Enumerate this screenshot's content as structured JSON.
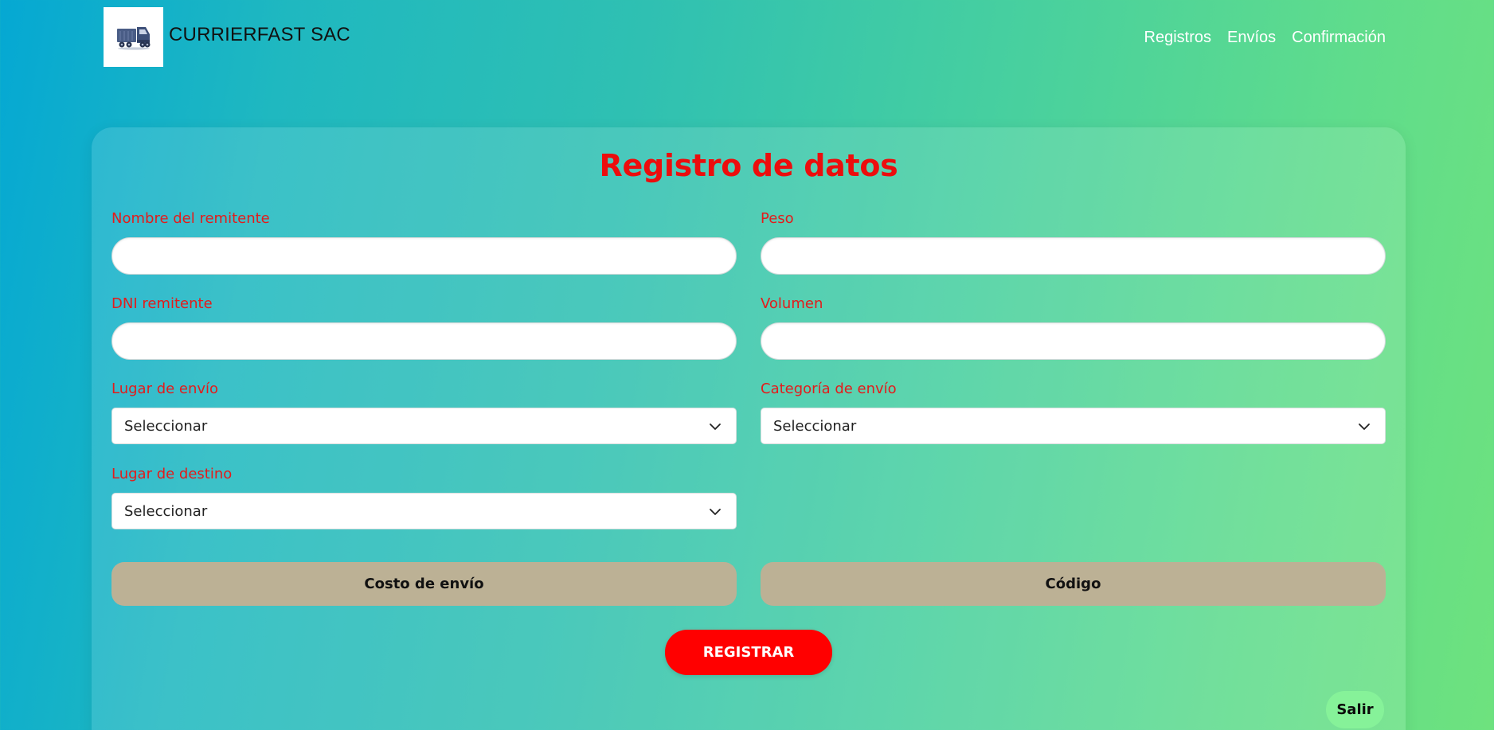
{
  "header": {
    "brand_name": "CURRIERFAST SAC",
    "logo_icon": "truck-icon",
    "nav": [
      {
        "label": "Registros"
      },
      {
        "label": "Envíos"
      },
      {
        "label": "Confirmación"
      }
    ]
  },
  "form": {
    "title": "Registro de datos",
    "fields": {
      "sender_name": {
        "label": "Nombre del remitente",
        "value": ""
      },
      "weight": {
        "label": "Peso",
        "value": ""
      },
      "sender_dni": {
        "label": "DNI remitente",
        "value": ""
      },
      "volume": {
        "label": "Volumen",
        "value": ""
      },
      "origin": {
        "label": "Lugar de envío",
        "selected": "Seleccionar"
      },
      "category": {
        "label": "Categoría de envío",
        "selected": "Seleccionar"
      },
      "destination": {
        "label": "Lugar de destino",
        "selected": "Seleccionar"
      }
    },
    "shipping_cost_label": "Costo de envío",
    "code_label": "Código",
    "register_label": "REGISTRAR",
    "exit_label": "Salir"
  },
  "colors": {
    "label_red": "#e41b1b",
    "title_red": "#ec0d0d",
    "register_button": "#ff0000",
    "result_button": "#bcb195",
    "exit_button": "#86f299"
  }
}
